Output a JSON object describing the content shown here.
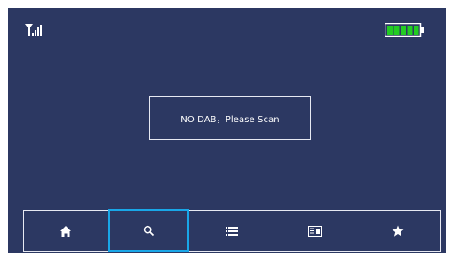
{
  "status_bar": {
    "signal_icon": "signal-strength-icon",
    "battery_icon": "battery-full-icon",
    "battery_color": "#22cc22"
  },
  "message": {
    "text": "NO DAB，Please Scan"
  },
  "nav_bar": {
    "items": [
      {
        "icon": "home-icon",
        "selected": false
      },
      {
        "icon": "search-icon",
        "selected": true
      },
      {
        "icon": "list-icon",
        "selected": false
      },
      {
        "icon": "station-scan-icon",
        "selected": false
      },
      {
        "icon": "favorite-star-icon",
        "selected": false
      }
    ],
    "selected_color": "#19a7e8"
  },
  "colors": {
    "background": "#2c3862",
    "border": "#e7e9f2",
    "text": "#ffffff"
  }
}
